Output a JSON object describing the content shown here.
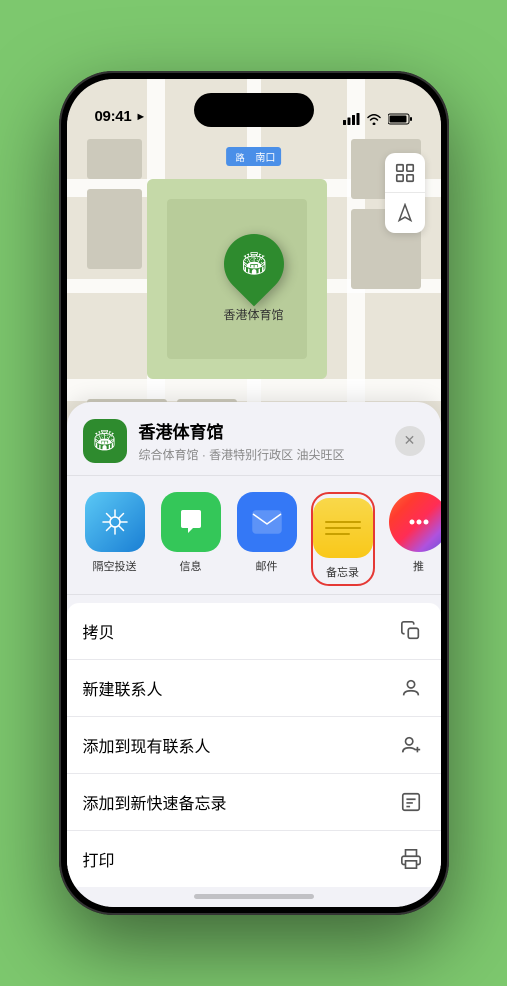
{
  "status_bar": {
    "time": "09:41",
    "location_icon": "▶"
  },
  "map": {
    "label_tag": "南口",
    "location_name": "香港体育馆",
    "pin_emoji": "🏟"
  },
  "map_controls": {
    "layers_icon": "⊞",
    "location_icon": "➤"
  },
  "sheet": {
    "venue_icon": "🏟",
    "venue_name": "香港体育馆",
    "venue_subtitle": "综合体育馆 · 香港特别行政区 油尖旺区",
    "close_label": "✕"
  },
  "share_items": [
    {
      "id": "airdrop",
      "label": "隔空投送",
      "type": "airdrop"
    },
    {
      "id": "messages",
      "label": "信息",
      "type": "messages"
    },
    {
      "id": "mail",
      "label": "邮件",
      "type": "mail"
    },
    {
      "id": "notes",
      "label": "备忘录",
      "type": "notes"
    },
    {
      "id": "more",
      "label": "推",
      "type": "more"
    }
  ],
  "actions": [
    {
      "id": "copy",
      "label": "拷贝",
      "icon": "copy"
    },
    {
      "id": "new-contact",
      "label": "新建联系人",
      "icon": "person"
    },
    {
      "id": "add-contact",
      "label": "添加到现有联系人",
      "icon": "person-add"
    },
    {
      "id": "quick-note",
      "label": "添加到新快速备忘录",
      "icon": "note"
    },
    {
      "id": "print",
      "label": "打印",
      "icon": "print"
    }
  ]
}
